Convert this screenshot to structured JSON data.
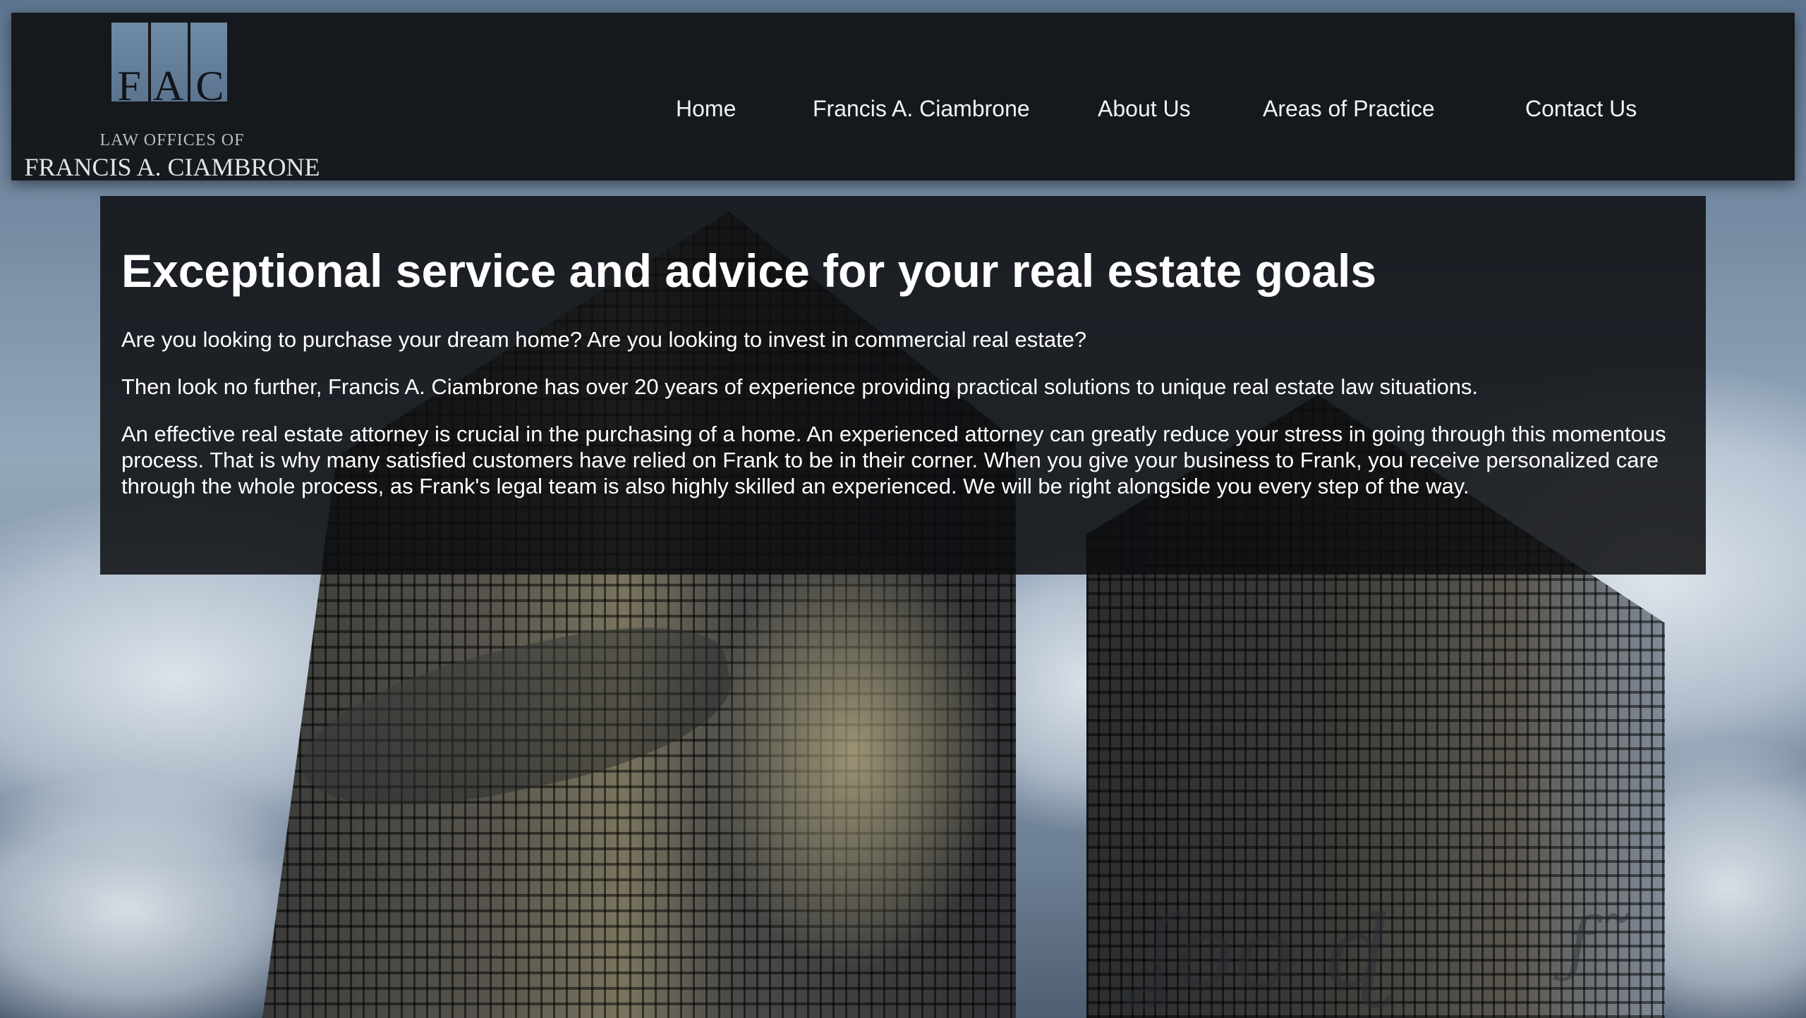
{
  "logo": {
    "letters": [
      "F",
      "A",
      "C"
    ],
    "line1": "LAW OFFICES OF",
    "line2": "FRANCIS A. CIAMBRONE"
  },
  "nav": {
    "items": [
      {
        "label": "Home"
      },
      {
        "label": "Francis A. Ciambrone"
      },
      {
        "label": "About Us"
      },
      {
        "label": "Areas of Practice"
      },
      {
        "label": "Contact Us"
      }
    ]
  },
  "main": {
    "heading": "Exceptional service and advice for your real estate goals",
    "paragraphs": [
      "Are you looking to purchase your dream home? Are you looking to invest in commercial real estate?",
      "Then look no further, Francis A. Ciambrone has over 20 years of experience providing practical solutions to unique real estate law situations.",
      "An effective real estate attorney is crucial in the purchasing of a home. An experienced attorney can greatly reduce your stress in going through this momentous process. That is why many satisfied customers have relied on Frank to be in their corner. When you give your business to Frank, you receive personalized care through the whole process, as Frank's legal team is also highly skilled an experienced. We will be right alongside you every step of the way."
    ]
  },
  "colors": {
    "header_bg": "#111316",
    "panel_bg": "#0c0d0f",
    "logo_box": "#6f8aa4",
    "text": "#ffffff"
  }
}
